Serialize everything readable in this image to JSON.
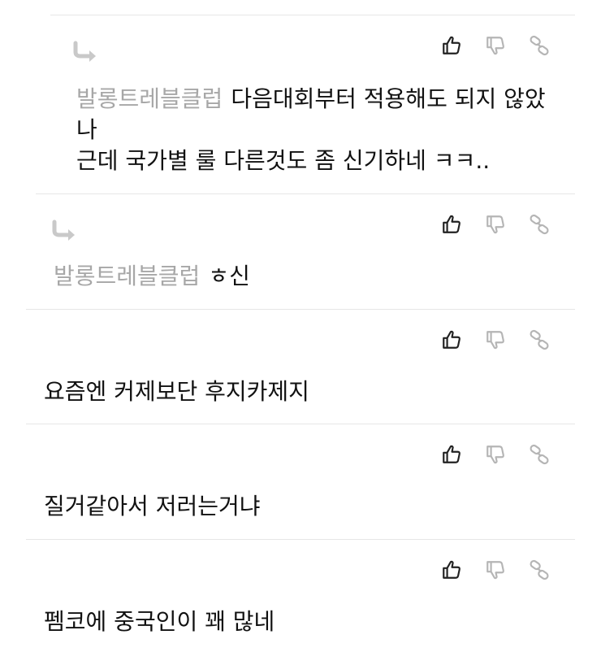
{
  "comments": [
    {
      "is_reply": true,
      "mention": "발롱트레블클럽",
      "text": "다음대회부터 적용해도 되지 않았\n나\n근데 국가별 룰 다른것도 좀 신기하네 ㅋㅋ.."
    },
    {
      "is_reply": true,
      "mention": "발롱트레블클럽",
      "text": "ㅎ신"
    },
    {
      "is_reply": false,
      "mention": "",
      "text": "요즘엔 커제보단 후지카제지"
    },
    {
      "is_reply": false,
      "mention": "",
      "text": "질거같아서 저러는거냐"
    },
    {
      "is_reply": false,
      "mention": "",
      "text": "펨코에 중국인이 꽤 많네"
    }
  ],
  "icons": {
    "like": "thumbs-up-icon",
    "dislike": "thumbs-down-icon",
    "share": "link-icon",
    "reply": "reply-arrow-icon"
  },
  "colors": {
    "mention": "#a7a7a7",
    "icon_active": "#222222",
    "icon_muted": "#b5b5b5",
    "divider": "#e6e6e6"
  }
}
